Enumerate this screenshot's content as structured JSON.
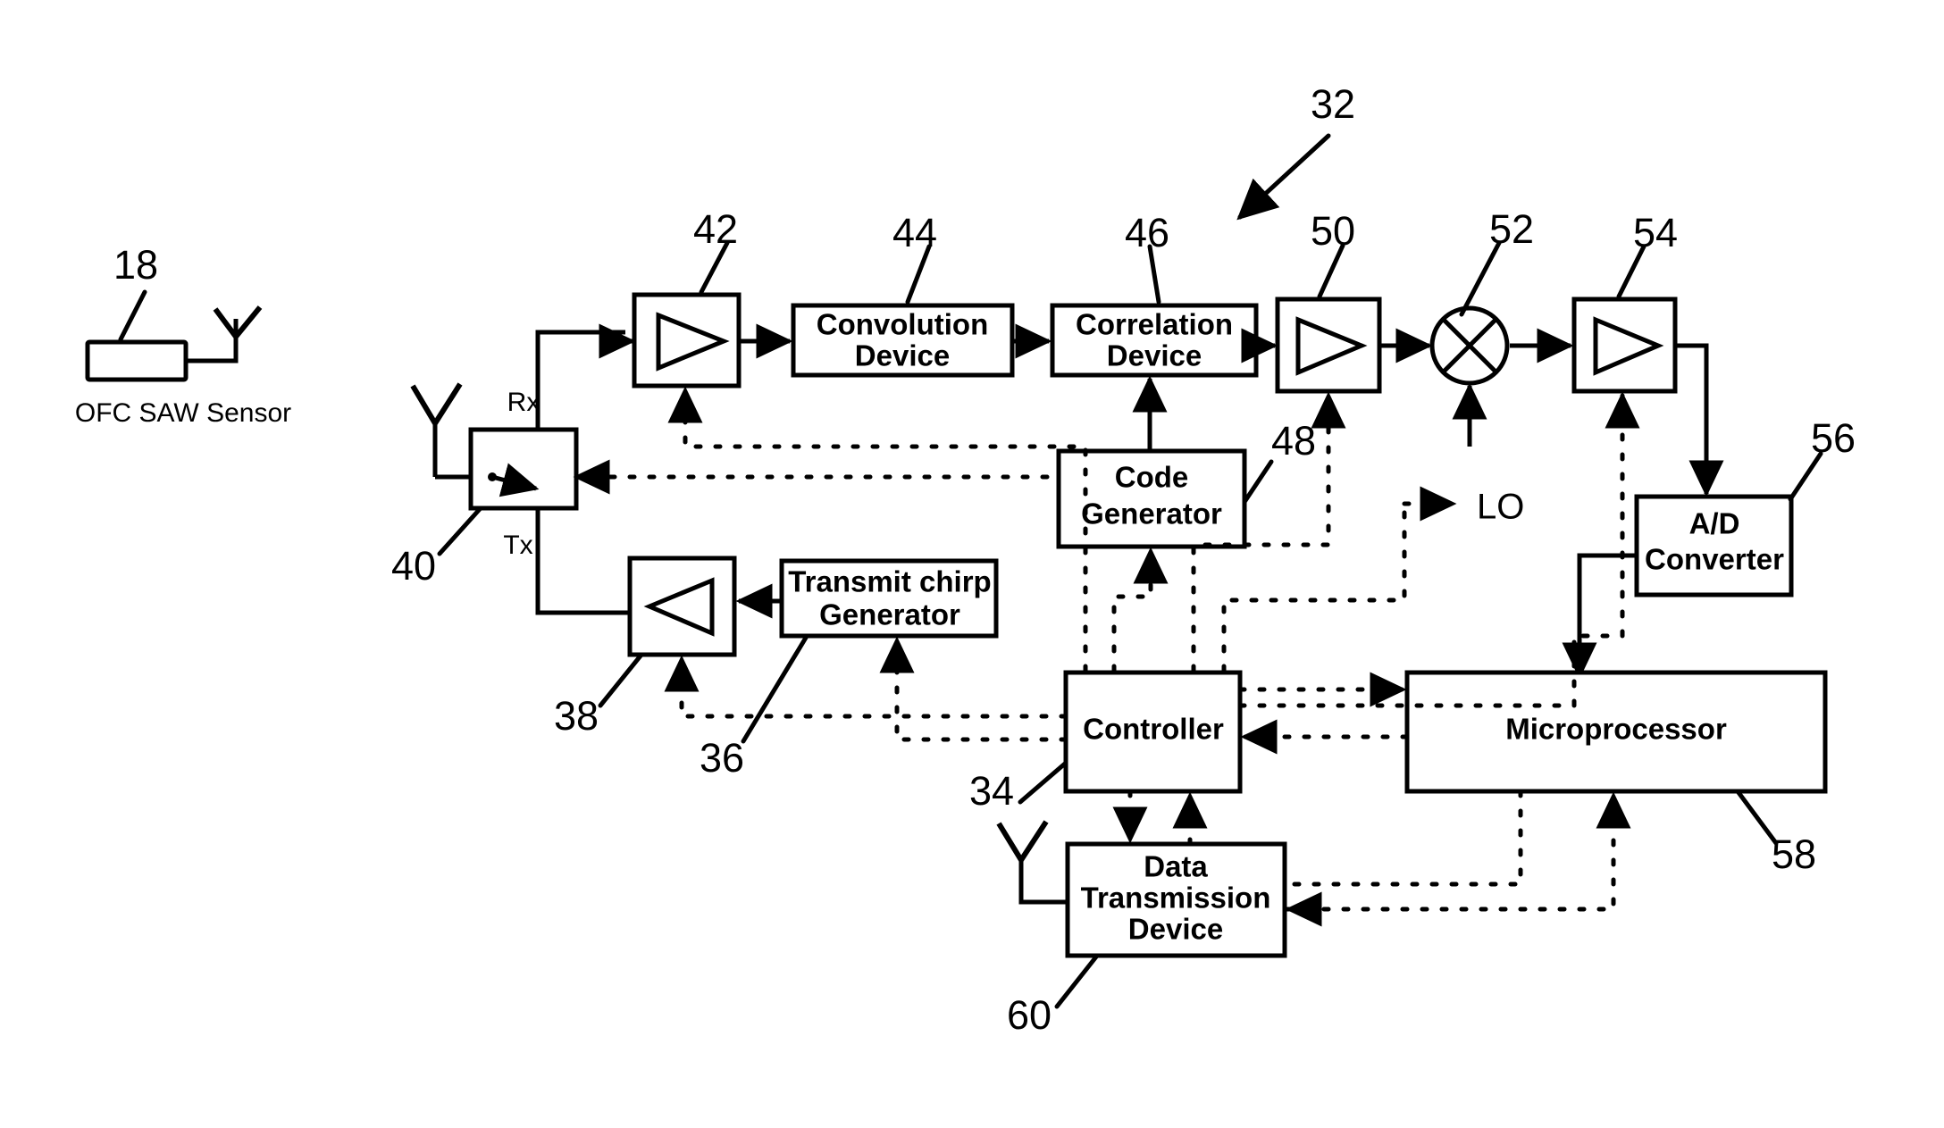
{
  "figure": {
    "type": "patent-block-diagram",
    "system_reference": "32",
    "background_color": "#ffffff",
    "line_color": "#000000"
  },
  "sensor": {
    "caption": "OFC SAW Sensor",
    "ref": "18",
    "antenna_icon": "antenna-icon"
  },
  "switch": {
    "ref": "40",
    "rx_label": "Rx",
    "tx_label": "Tx",
    "antenna_icon": "antenna-icon"
  },
  "blocks": [
    {
      "id": "amp-rx",
      "label": "",
      "ref": "42",
      "icon": "amplifier-triangle-right-icon"
    },
    {
      "id": "convolution-device",
      "label": "Convolution\nDevice",
      "line1": "Convolution",
      "line2": "Device",
      "ref": "44"
    },
    {
      "id": "correlation-device",
      "label": "Correlation\nDevice",
      "line1": "Correlation",
      "line2": "Device",
      "ref": "46"
    },
    {
      "id": "code-generator",
      "label": "Code\nGenerator",
      "line1": "Code",
      "line2": "Generator",
      "ref": "48"
    },
    {
      "id": "amp-if",
      "label": "",
      "ref": "50",
      "icon": "amplifier-triangle-right-icon"
    },
    {
      "id": "mixer",
      "label": "",
      "ref": "52",
      "icon": "mixer-circle-x-icon"
    },
    {
      "id": "amp-out",
      "label": "",
      "ref": "54",
      "icon": "amplifier-triangle-right-icon"
    },
    {
      "id": "ad-converter",
      "line1": "A/D",
      "line2": "Converter",
      "ref": "56"
    },
    {
      "id": "amp-tx",
      "label": "",
      "ref": "38",
      "icon": "amplifier-triangle-left-icon"
    },
    {
      "id": "transmit-chirp-generator",
      "line1": "Transmit chirp",
      "line2": "Generator",
      "ref": "36"
    },
    {
      "id": "controller",
      "line1": "Controller",
      "ref": "34"
    },
    {
      "id": "microprocessor",
      "line1": "Microprocessor",
      "ref": "58"
    },
    {
      "id": "data-transmission-device",
      "line1": "Data",
      "line2": "Transmission",
      "line3": "Device",
      "ref": "60"
    }
  ],
  "labels": {
    "lo": "LO",
    "convolution_l1": "Convolution",
    "convolution_l2": "Device",
    "correlation_l1": "Correlation",
    "correlation_l2": "Device",
    "code_l1": "Code",
    "code_l2": "Generator",
    "ad_l1": "A/D",
    "ad_l2": "Converter",
    "chirp_l1": "Transmit chirp",
    "chirp_l2": "Generator",
    "controller": "Controller",
    "microprocessor": "Microprocessor",
    "data_l1": "Data",
    "data_l2": "Transmission",
    "data_l3": "Device",
    "sensor_caption": "OFC SAW Sensor",
    "rx": "Rx",
    "tx": "Tx"
  },
  "refnums": {
    "n18": "18",
    "n32": "32",
    "n34": "34",
    "n36": "36",
    "n38": "38",
    "n40": "40",
    "n42": "42",
    "n44": "44",
    "n46": "46",
    "n48": "48",
    "n50": "50",
    "n52": "52",
    "n54": "54",
    "n56": "56",
    "n58": "58",
    "n60": "60"
  }
}
